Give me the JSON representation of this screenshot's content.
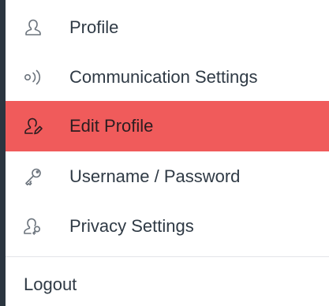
{
  "menu": {
    "items": [
      {
        "label": "Profile",
        "icon": "user-icon"
      },
      {
        "label": "Communication Settings",
        "icon": "broadcast-icon"
      },
      {
        "label": "Edit Profile",
        "icon": "user-edit-icon",
        "active": true
      },
      {
        "label": "Username / Password",
        "icon": "key-icon"
      },
      {
        "label": "Privacy Settings",
        "icon": "user-key-icon"
      }
    ],
    "logout_label": "Logout"
  },
  "colors": {
    "active_background": "#f05b5b",
    "panel_background": "#ffffff",
    "page_background": "#2b3540",
    "text": "#2f3a45",
    "icon": "#6b737c"
  }
}
